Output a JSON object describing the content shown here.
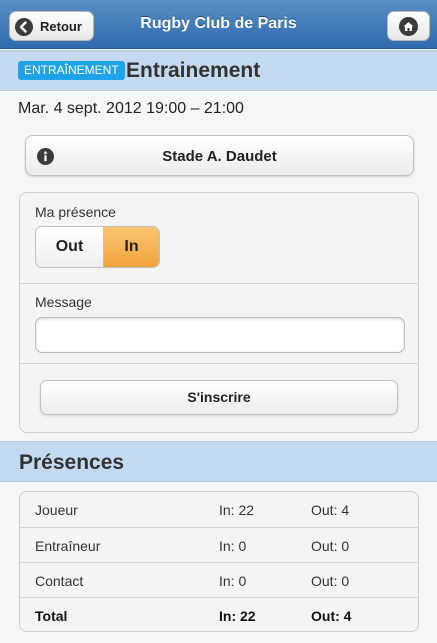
{
  "header": {
    "title": "Rugby Club de Paris",
    "back_label": "Retour",
    "back_icon": "chevron-left-icon",
    "home_icon": "home-icon"
  },
  "event": {
    "badge": "ENTRAÎNEMENT",
    "title": "Entrainement",
    "date": "Mar. 4 sept. 2012 19:00 – 21:00",
    "venue": "Stade A. Daudet",
    "venue_icon": "info-icon"
  },
  "form": {
    "presence_label": "Ma présence",
    "options": [
      "Out",
      "In"
    ],
    "selected": "In",
    "message_label": "Message",
    "message_value": "",
    "submit_label": "S'inscrire"
  },
  "presences": {
    "title": "Présences",
    "rows": [
      {
        "role": "Joueur",
        "in": "In: 22",
        "out": "Out: 4"
      },
      {
        "role": "Entraîneur",
        "in": "In: 0",
        "out": "Out: 0"
      },
      {
        "role": "Contact",
        "in": "In: 0",
        "out": "Out: 0"
      },
      {
        "role": "Total",
        "in": "In: 22",
        "out": "Out: 4"
      }
    ]
  },
  "colors": {
    "header": "#2f6bad",
    "section_bar": "#c4daf0",
    "badge": "#1fa3e8",
    "selected_toggle": "#f2a33d"
  }
}
